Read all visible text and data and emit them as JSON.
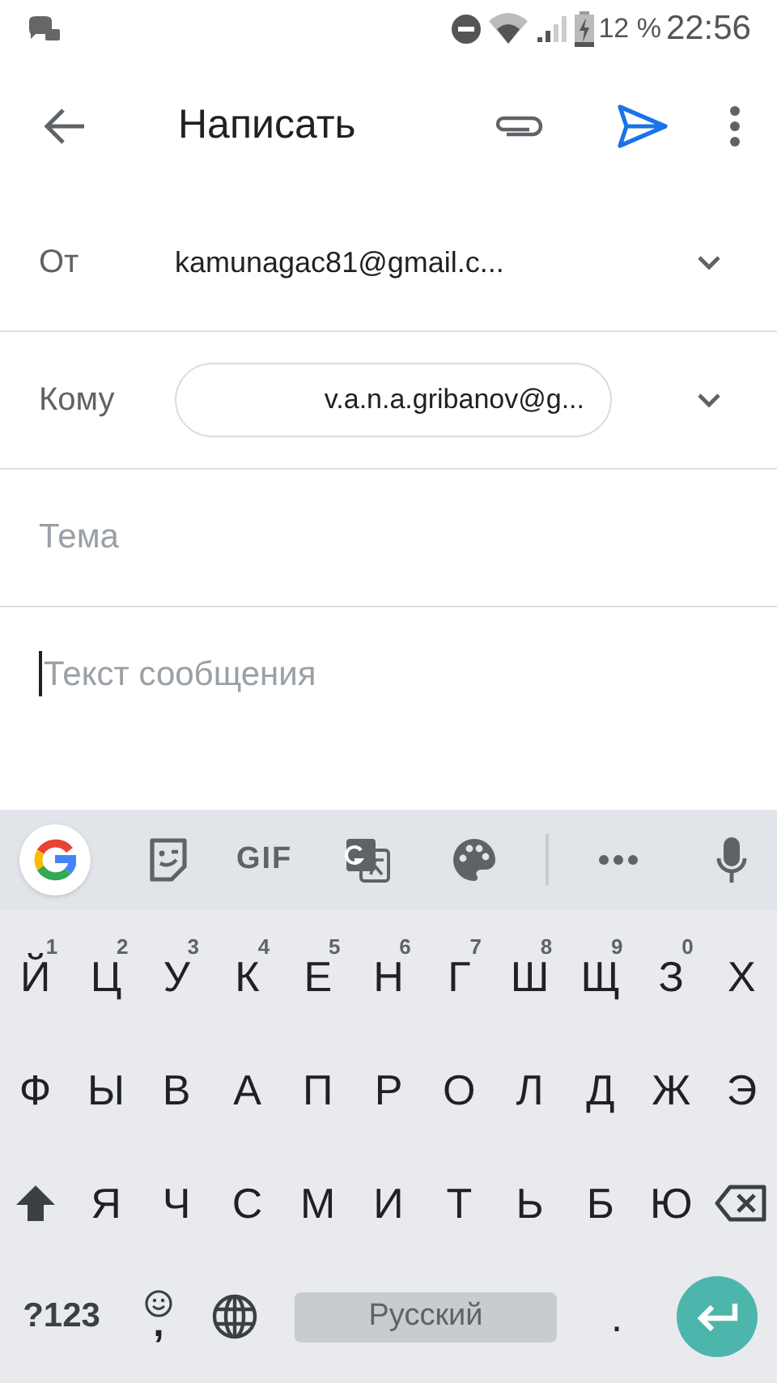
{
  "status_bar": {
    "battery": "12 %",
    "time": "22:56"
  },
  "app_bar": {
    "title": "Написать"
  },
  "fields": [
    {
      "kind": "select",
      "label": "От",
      "value": "kamunagac81@gmail.c..."
    },
    {
      "kind": "chip",
      "label": "Кому",
      "value": "v.a.n.a.gribanov@g..."
    },
    {
      "kind": "input",
      "placeholder": "Тема"
    }
  ],
  "body": {
    "placeholder": "Текст сообщения"
  },
  "keyboard": {
    "toolbar": {
      "gif": "GIF"
    },
    "rows": [
      [
        {
          "kind": "letter",
          "label": "Й",
          "hint": "1"
        },
        {
          "kind": "letter",
          "label": "Ц",
          "hint": "2"
        },
        {
          "kind": "letter",
          "label": "У",
          "hint": "3"
        },
        {
          "kind": "letter",
          "label": "К",
          "hint": "4"
        },
        {
          "kind": "letter",
          "label": "Е",
          "hint": "5"
        },
        {
          "kind": "letter",
          "label": "Н",
          "hint": "6"
        },
        {
          "kind": "letter",
          "label": "Г",
          "hint": "7"
        },
        {
          "kind": "letter",
          "label": "Ш",
          "hint": "8"
        },
        {
          "kind": "letter",
          "label": "Щ",
          "hint": "9"
        },
        {
          "kind": "letter",
          "label": "З",
          "hint": "0"
        },
        {
          "kind": "letter",
          "label": "Х"
        }
      ],
      [
        {
          "kind": "letter",
          "label": "Ф"
        },
        {
          "kind": "letter",
          "label": "Ы"
        },
        {
          "kind": "letter",
          "label": "В"
        },
        {
          "kind": "letter",
          "label": "А"
        },
        {
          "kind": "letter",
          "label": "П"
        },
        {
          "kind": "letter",
          "label": "Р"
        },
        {
          "kind": "letter",
          "label": "О"
        },
        {
          "kind": "letter",
          "label": "Л"
        },
        {
          "kind": "letter",
          "label": "Д"
        },
        {
          "kind": "letter",
          "label": "Ж"
        },
        {
          "kind": "letter",
          "label": "Э"
        }
      ],
      [
        {
          "kind": "shift"
        },
        {
          "kind": "letter",
          "label": "Я"
        },
        {
          "kind": "letter",
          "label": "Ч"
        },
        {
          "kind": "letter",
          "label": "С"
        },
        {
          "kind": "letter",
          "label": "М"
        },
        {
          "kind": "letter",
          "label": "И"
        },
        {
          "kind": "letter",
          "label": "Т"
        },
        {
          "kind": "letter",
          "label": "Ь"
        },
        {
          "kind": "letter",
          "label": "Б"
        },
        {
          "kind": "letter",
          "label": "Ю"
        },
        {
          "kind": "backspace"
        }
      ]
    ],
    "bottom_row": [
      {
        "kind": "symbols",
        "label": "?123"
      },
      {
        "kind": "emoji",
        "label": ","
      },
      {
        "kind": "globe"
      },
      {
        "kind": "space",
        "label": "Русский"
      },
      {
        "kind": "period",
        "label": "."
      },
      {
        "kind": "enter"
      }
    ]
  }
}
